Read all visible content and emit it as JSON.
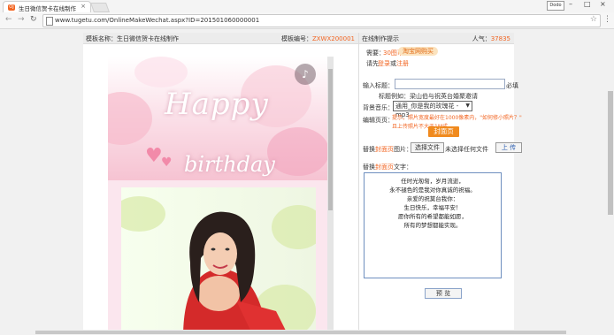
{
  "browser": {
    "tab_title": "生日微信贺卡在线制作",
    "tab_favicon": "OJ",
    "window_badge": "Dodo",
    "url": "www.tugetu.com/OnlineMakeWechat.aspx?ID=201501060000001"
  },
  "left_panel": {
    "template_label": "模板名称：生日微信贺卡在线制作",
    "template_no_label": "模板编号：",
    "template_no": "ZXWX200001",
    "card": {
      "title_happy": "Happy",
      "title_birthday": "birthday"
    }
  },
  "right_panel": {
    "header_title": "在线制作提示",
    "popularity_label": "人气：",
    "popularity": "37835",
    "price_label": "需要：",
    "price": "30图币",
    "taobao_button": "淘宝网购买",
    "login_prefix": "请先",
    "login_link": "登录",
    "login_or": "或",
    "register_link": "注册",
    "title_input_label": "输入标题：",
    "required_label": "必填",
    "title_reference": "标题例如：梁山伯与祝英台婚聚邀请",
    "music_label": "背景音乐：",
    "music_selected": "通用_你是我的玫瑰花 -mp3",
    "edit_page_label": "编辑页页：",
    "edit_tip_line1": "提示，照片宽度最好在1000像素内，\"如何修小照片？\"",
    "edit_tip_line2": "且上传照片不大于1M成",
    "cover_button": "封面页",
    "replace_cover_image_prefix": "替换",
    "replace_cover_image_link": "封面页",
    "replace_cover_image_suffix": "图片：",
    "choose_file_button": "选择文件",
    "no_file_text": "未选择任何文件",
    "upload_button": "上 传",
    "replace_text_prefix": "替换",
    "replace_text_link": "封面页",
    "replace_text_suffix": "文字：",
    "greeting_lines": [
      "任时光匆匆，岁月流逝，",
      "永不褪色的是我对你真诚的祝福。",
      "亲爱的祝莫台我你：",
      "生日快乐，幸福平安！",
      "愿你所有的希望都能如愿，",
      "所有的梦想都能实现。"
    ],
    "preview_button": "预 览"
  }
}
